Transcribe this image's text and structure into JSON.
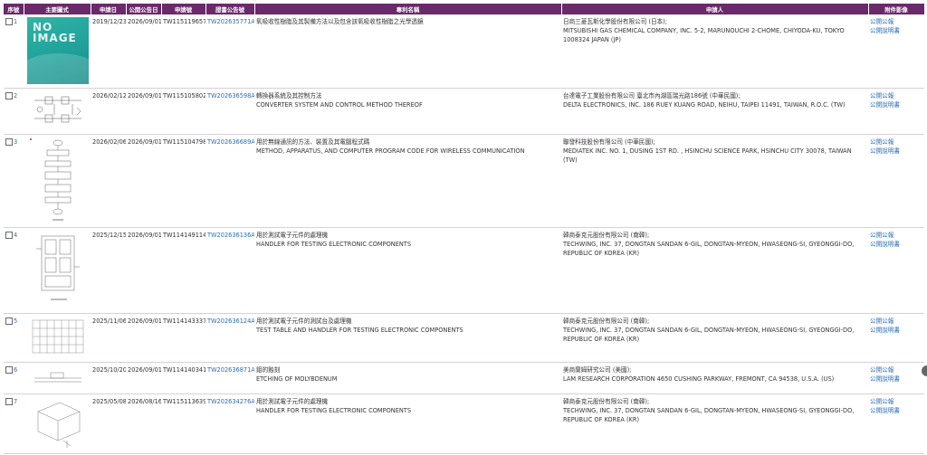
{
  "headers": [
    "序號",
    "主要圖式",
    "申請日",
    "公開公告日",
    "申請號",
    "證書公告號",
    "專利名稱",
    "申請人",
    "附件影像"
  ],
  "rows": [
    {
      "no": "1",
      "app_date": "2019/12/23",
      "pub_date": "2026/09/01",
      "app_no": "TW115119657",
      "pub_no": "TW202635771A",
      "title_zh": "氧吸收性樹脂及其製備方法以及包含該氧吸收性樹脂之光學透鏡",
      "title_en": "",
      "applicant_zh": "日商三菱瓦斯化學股份有限公司 (日本);",
      "applicant_en": "MITSUBISHI GAS CHEMICAL COMPANY, INC. 5-2, MARUNOUCHI 2-CHOME, CHIYODA-KU, TOKYO 1008324 JAPAN (JP)",
      "img": "no-image",
      "no_image_text": "NO IMAGE"
    },
    {
      "no": "2",
      "app_date": "2026/02/12",
      "pub_date": "2026/09/01",
      "app_no": "TW115105802",
      "pub_no": "TW202636598A",
      "title_zh": "轉換器系統及其控制方法",
      "title_en": "CONVERTER SYSTEM AND CONTROL METHOD THEREOF",
      "applicant_zh": "台達電子工業股份有限公司 臺北市內湖區瑞光路186號 (中華民國);",
      "applicant_en": "DELTA ELECTRONICS, INC. 186 RUEY KUANG ROAD, NEIHU, TAIPEI 11491, TAIWAN, R.O.C. (TW)",
      "img": "circuit"
    },
    {
      "no": "3",
      "app_date": "2026/02/06",
      "pub_date": "2026/09/01",
      "app_no": "TW115104798",
      "pub_no": "TW202636689A",
      "title_zh": "用於無線通訊的方法、裝置及其電腦程式碼",
      "title_en": "METHOD, APPARATUS, AND COMPUTER PROGRAM CODE FOR WIRELESS COMMUNICATION",
      "applicant_zh": "聯發科技股份有限公司 (中華民國);",
      "applicant_en": "MEDIATEK INC. NO. 1, DUSING 1ST RD. , HSINCHU SCIENCE PARK, HSINCHU CITY 30078, TAIWAN (TW)",
      "img": "flowchart"
    },
    {
      "no": "4",
      "app_date": "2025/12/15",
      "pub_date": "2026/09/01",
      "app_no": "TW114149114",
      "pub_no": "TW202636136A",
      "title_zh": "用於測試電子元件的處理機",
      "title_en": "HANDLER FOR TESTING ELECTRONIC COMPONENTS",
      "applicant_zh": "韓商泰克元股份有限公司 (南韓);",
      "applicant_en": "TECHWING, INC. 37, DONGTAN SANDAN 6-GIL, DONGTAN-MYEON, HWASEONG-SI, GYEONGGI-DO, REPUBLIC OF KOREA (KR)",
      "img": "handler"
    },
    {
      "no": "5",
      "app_date": "2025/11/06",
      "pub_date": "2026/09/01",
      "app_no": "TW114143337",
      "pub_no": "TW202636124A",
      "title_zh": "用於測試電子元件的測試台及處理機",
      "title_en": "TEST TABLE AND HANDLER FOR TESTING ELECTRONIC COMPONENTS",
      "applicant_zh": "韓商泰克元股份有限公司 (南韓);",
      "applicant_en": "TECHWING, INC. 37, DONGTAN SANDAN 6-GIL, DONGTAN-MYEON, HWASEONG-SI, GYEONGGI-DO, REPUBLIC OF KOREA (KR)",
      "img": "grid"
    },
    {
      "no": "6",
      "app_date": "2025/10/20",
      "pub_date": "2026/09/01",
      "app_no": "TW114140341",
      "pub_no": "TW202636871A",
      "title_zh": "鉬的蝕刻",
      "title_en": "ETCHING OF MOLYBDENUM",
      "applicant_zh": "美商蘭姆研究公司 (美國);",
      "applicant_en": "LAM RESEARCH CORPORATION 4650 CUSHING PARKWAY, FREMONT, CA 94538, U.S.A. (US)",
      "img": "layers"
    },
    {
      "no": "7",
      "app_date": "2025/05/08",
      "pub_date": "2026/08/16",
      "app_no": "TW115113639",
      "pub_no": "TW202634276A",
      "title_zh": "用於測試電子元件的處理機",
      "title_en": "HANDLER FOR TESTING ELECTRONIC COMPONENTS",
      "applicant_zh": "韓商泰克元股份有限公司 (南韓);",
      "applicant_en": "TECHWING, INC. 37, DONGTAN SANDAN 6-GIL, DONGTAN-MYEON, HWASEONG-SI, GYEONGGI-DO, REPUBLIC OF KOREA (KR)",
      "img": "cube"
    }
  ],
  "links": {
    "gazette": "公開公報",
    "description": "公開說明書"
  },
  "colors": {
    "header_bg": "#6a2a6a",
    "link": "#2b6cb0"
  }
}
